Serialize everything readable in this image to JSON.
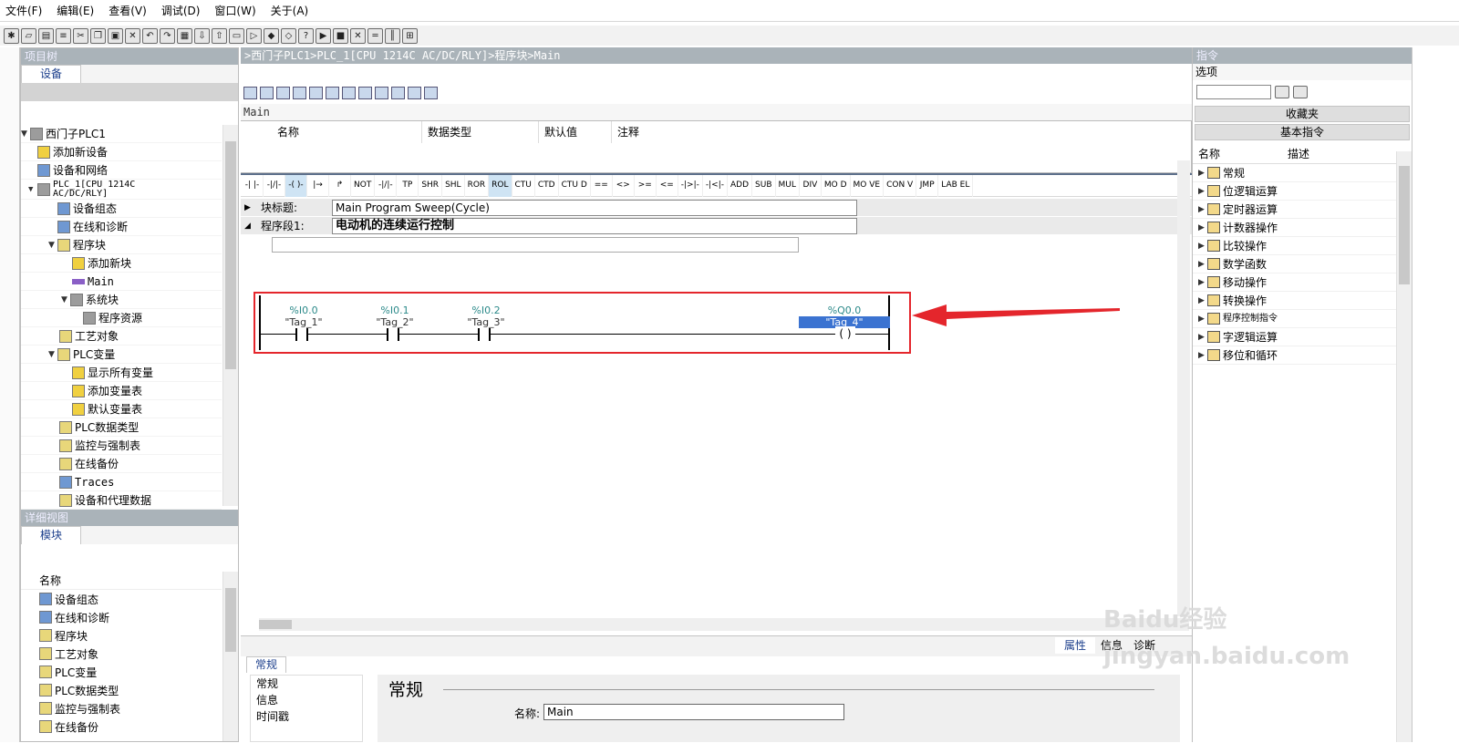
{
  "menu": [
    "文件(F)",
    "编辑(E)",
    "查看(V)",
    "调试(D)",
    "窗口(W)",
    "关于(A)"
  ],
  "left": {
    "title": "项目树",
    "tab": "设备",
    "tree": [
      {
        "label": "西门子PLC1",
        "icon": "plc-icon"
      },
      {
        "label": "添加新设备",
        "icon": "add-device-icon"
      },
      {
        "label": "设备和网络",
        "icon": "network-icon"
      },
      {
        "label": "PLC_1[CPU 1214C AC/DC/RLY]",
        "icon": "cpu-icon"
      },
      {
        "label": "设备组态",
        "icon": "device-config-icon"
      },
      {
        "label": "在线和诊断",
        "icon": "diagnostics-icon"
      },
      {
        "label": "程序块",
        "icon": "folder-icon"
      },
      {
        "label": "添加新块",
        "icon": "add-block-icon"
      },
      {
        "label": "Main",
        "icon": "main-block-icon"
      },
      {
        "label": "系统块",
        "icon": "system-block-icon"
      },
      {
        "label": "程序资源",
        "icon": "program-resource-icon"
      },
      {
        "label": "工艺对象",
        "icon": "tech-object-icon"
      },
      {
        "label": "PLC变量",
        "icon": "folder-icon"
      },
      {
        "label": "显示所有变量",
        "icon": "show-vars-icon"
      },
      {
        "label": "添加变量表",
        "icon": "add-table-icon"
      },
      {
        "label": "默认变量表",
        "icon": "default-table-icon"
      },
      {
        "label": "PLC数据类型",
        "icon": "datatype-icon"
      },
      {
        "label": "监控与强制表",
        "icon": "watch-table-icon"
      },
      {
        "label": "在线备份",
        "icon": "backup-icon"
      },
      {
        "label": "Traces",
        "icon": "traces-icon"
      },
      {
        "label": "设备和代理数据",
        "icon": "proxy-data-icon"
      }
    ],
    "detail_title": "详细视图",
    "detail_tab": "模块",
    "detail_header": "名称",
    "detail_rows": [
      "设备组态",
      "在线和诊断",
      "程序块",
      "工艺对象",
      "PLC变量",
      "PLC数据类型",
      "监控与强制表",
      "在线备份"
    ]
  },
  "editor": {
    "breadcrumb": ">西门子PLC1>PLC_1[CPU 1214C AC/DC/RLY]>程序块>Main",
    "block_name": "Main",
    "interface_headers": [
      "名称",
      "数据类型",
      "默认值",
      "注释"
    ],
    "ladder_tools": [
      "-| |-",
      "-|/|-",
      "-( )-",
      "|→",
      "↱",
      "NOT",
      "-|/|-",
      "TP",
      "SHR",
      "SHL",
      "ROR",
      "ROL",
      "CTU",
      "CTD",
      "CTU D",
      "== ",
      "<> ",
      ">= ",
      "<= ",
      "-|>|-",
      "-|<|-",
      "ADD",
      "SUB",
      "MUL",
      "DIV",
      "MO D",
      "MO VE",
      "CON V",
      "JMP",
      "LAB EL"
    ],
    "block_title_label": "块标题:",
    "block_title_value": "Main Program Sweep(Cycle)",
    "segment_label": "程序段1:",
    "segment_value": "电动机的连续运行控制",
    "contacts": [
      {
        "address": "%I0.0",
        "tag": "\"Tag_1\""
      },
      {
        "address": "%I0.1",
        "tag": "\"Tag_2\""
      },
      {
        "address": "%I0.2",
        "tag": "\"Tag_3\""
      }
    ],
    "coil": {
      "address": "%Q0.0",
      "tag": "\"Tag_4\""
    }
  },
  "right": {
    "title": "指令",
    "options": "选项",
    "favorites": "收藏夹",
    "basic": "基本指令",
    "col_name": "名称",
    "col_desc": "描述",
    "items": [
      "常规",
      "位逻辑运算",
      "定时器运算",
      "计数器操作",
      "比较操作",
      "数学函数",
      "移动操作",
      "转换操作",
      "程序控制指令",
      "字逻辑运算",
      "移位和循环"
    ]
  },
  "bottom": {
    "tabs": [
      "属性",
      "信息",
      "诊断"
    ],
    "tab": "常规",
    "nav": [
      "常规",
      "信息",
      "时间戳"
    ],
    "section": "常规",
    "name_label": "名称:",
    "name_value": "Main"
  },
  "watermark": "Baidu经验 jingyan.baidu.com",
  "colors": {
    "accent": "#1c3f8c",
    "highlight": "#e4262c",
    "coil_tag_bg": "#3b73d1"
  }
}
